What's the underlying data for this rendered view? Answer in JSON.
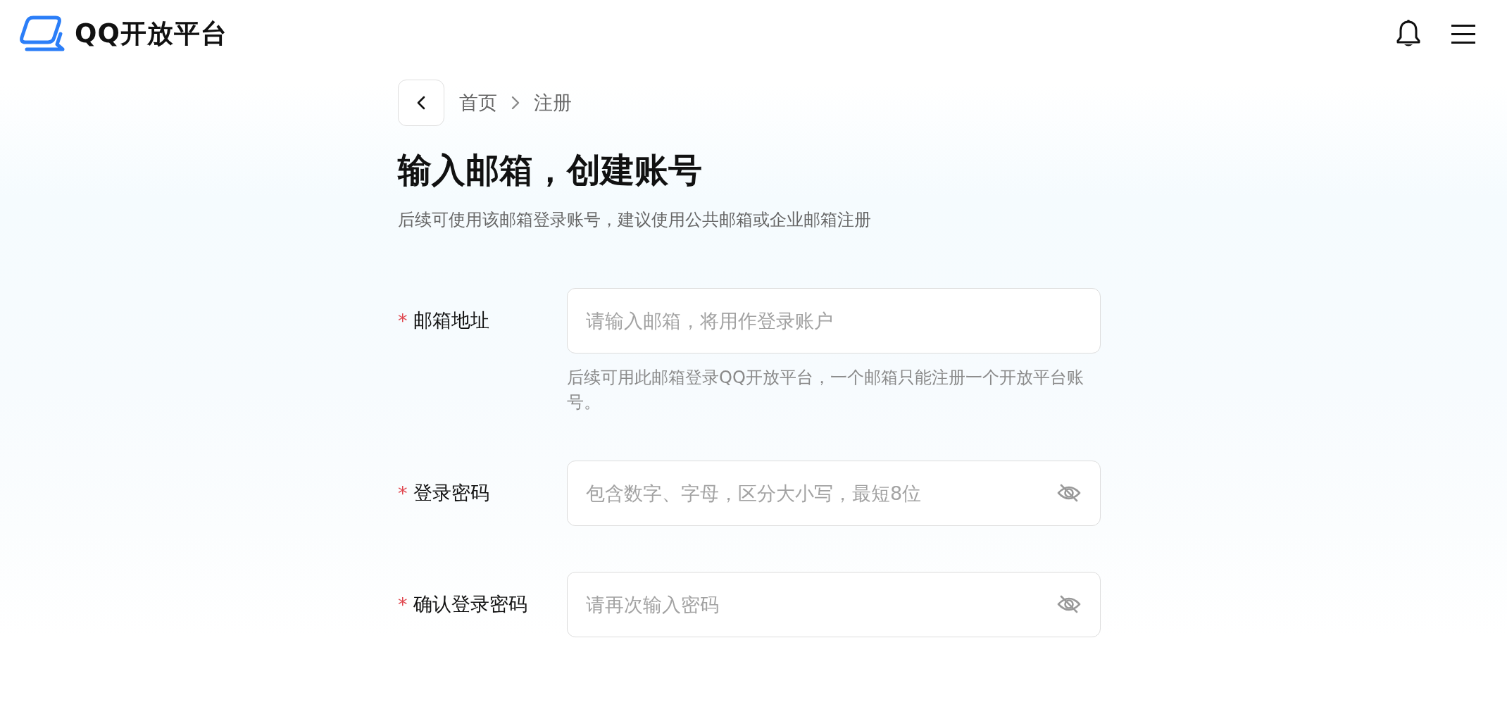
{
  "header": {
    "logo_text": "QQ开放平台"
  },
  "breadcrumb": {
    "items": [
      "首页",
      "注册"
    ]
  },
  "title": "输入邮箱，创建账号",
  "subtitle": "后续可使用该邮箱登录账号，建议使用公共邮箱或企业邮箱注册",
  "form": {
    "fields": [
      {
        "kind": "text",
        "required_mark": "*",
        "label": "邮箱地址",
        "placeholder": "请输入邮箱，将用作登录账户",
        "help": "后续可用此邮箱登录QQ开放平台，一个邮箱只能注册一个开放平台账号。"
      },
      {
        "kind": "password",
        "required_mark": "*",
        "label": "登录密码",
        "placeholder": "包含数字、字母，区分大小写，最短8位"
      },
      {
        "kind": "password",
        "required_mark": "*",
        "label": "确认登录密码",
        "placeholder": "请再次输入密码"
      }
    ]
  }
}
